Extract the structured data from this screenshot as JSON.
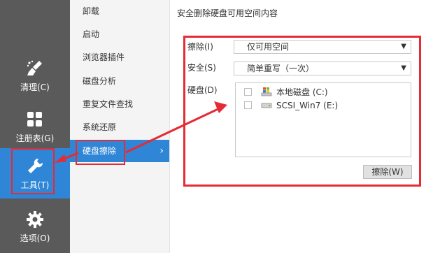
{
  "nav": {
    "items": [
      {
        "label": "清理(C)",
        "icon": "broom-icon"
      },
      {
        "label": "注册表(G)",
        "icon": "grid-icon"
      },
      {
        "label": "工具(T)",
        "icon": "wrench-icon"
      },
      {
        "label": "选项(O)",
        "icon": "gear-icon"
      }
    ],
    "selected_color": "#2f86d6"
  },
  "tools_menu": {
    "items": [
      "卸载",
      "启动",
      "浏览器插件",
      "磁盘分析",
      "重复文件查找",
      "系统还原",
      "硬盘擦除"
    ],
    "selected": "硬盘擦除",
    "chevron": "›"
  },
  "main": {
    "title": "安全删除硬盘可用空间内容",
    "erase_label": "擦除(I)",
    "erase_value": "仅可用空间",
    "security_label": "安全(S)",
    "security_value": "简单重写（一次）",
    "drives_label": "硬盘(D)",
    "drives": [
      {
        "name": "本地磁盘 (C:)",
        "icon": "windows-drive-icon",
        "checked": false
      },
      {
        "name": "SCSI_Win7 (E:)",
        "icon": "drive-icon",
        "checked": false
      }
    ],
    "erase_button": "擦除(W)"
  },
  "annotation_color": "#e52b33"
}
